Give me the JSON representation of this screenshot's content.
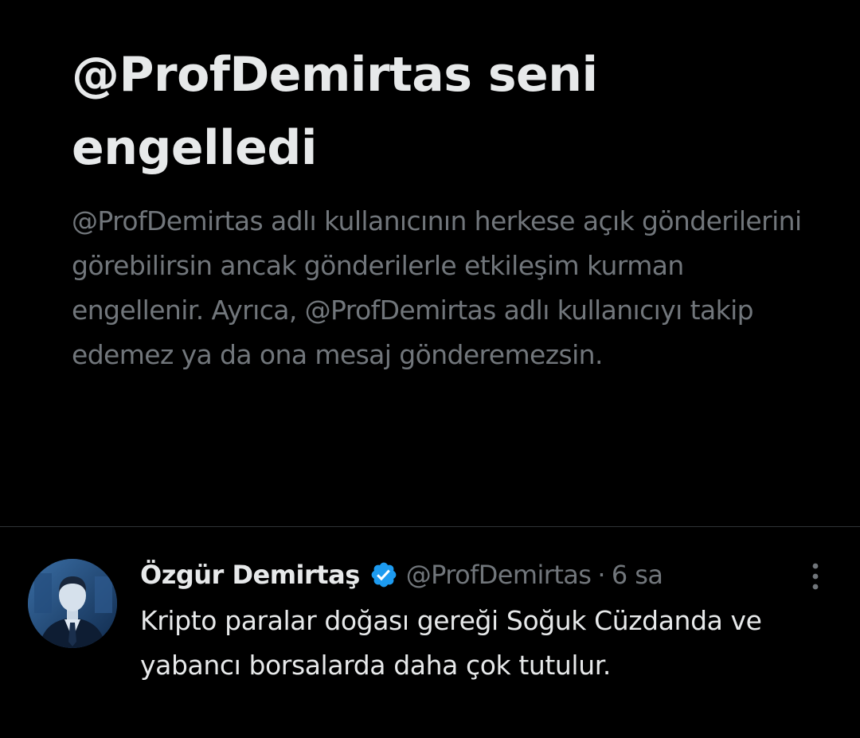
{
  "block_notice": {
    "title": "@ProfDemirtas seni engelledi",
    "description": "@ProfDemirtas adlı kullanıcının herkese açık gönderilerini görebilirsin ancak gönderilerle etkileşim kurman engellenir. Ayrıca, @ProfDemirtas adlı kullanıcıyı takip edemez ya da ona mesaj gönderemezsin."
  },
  "tweet": {
    "display_name": "Özgür Demirtaş",
    "verified": true,
    "verified_icon": "verified-badge-icon",
    "handle": "@ProfDemirtas",
    "separator": "·",
    "time": "6 sa",
    "text": "Kripto paralar doğası gereği Soğuk Cüzdanda ve yabancı borsalarda daha çok tutulur.",
    "more_icon": "more-vertical-icon",
    "avatar": "profile-photo"
  },
  "colors": {
    "background": "#000000",
    "primary_text": "#e7e9ea",
    "secondary_text": "#71767b",
    "divider": "#2f3336",
    "verified_blue": "#1d9bf0"
  }
}
